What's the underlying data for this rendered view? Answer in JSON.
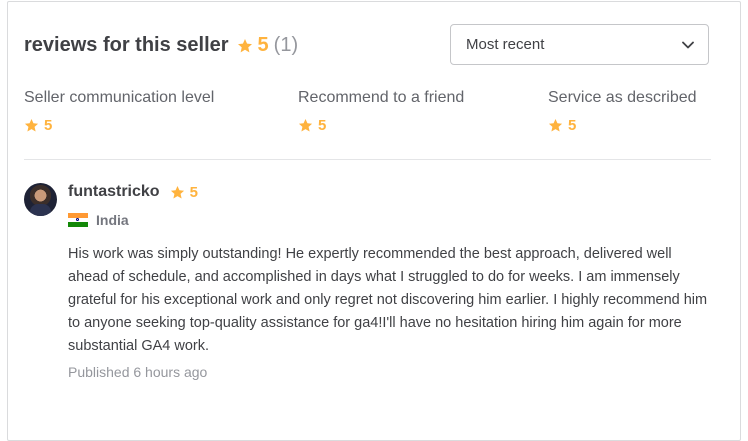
{
  "header": {
    "title": "reviews for this seller",
    "rating": "5",
    "count": "(1)",
    "star_color": "#ffb33e"
  },
  "sort_select": {
    "selected": "Most recent",
    "icon": "chevron-down-icon"
  },
  "metrics": [
    {
      "label": "Seller communication level",
      "value": "5"
    },
    {
      "label": "Recommend to a friend",
      "value": "5"
    },
    {
      "label": "Service as described",
      "value": "5"
    }
  ],
  "review": {
    "username": "funtastricko",
    "rating": "5",
    "country": "India",
    "text": "His work was simply outstanding! He expertly recommended the best approach, delivered well ahead of schedule, and accomplished in days what I struggled to do for weeks. I am immensely grateful for his exceptional work and only regret not discovering him earlier. I highly recommend him to anyone seeking top-quality assistance for ga4!I'll have no hesitation hiring him again for more substantial GA4 work.",
    "published": "Published 6 hours ago"
  }
}
